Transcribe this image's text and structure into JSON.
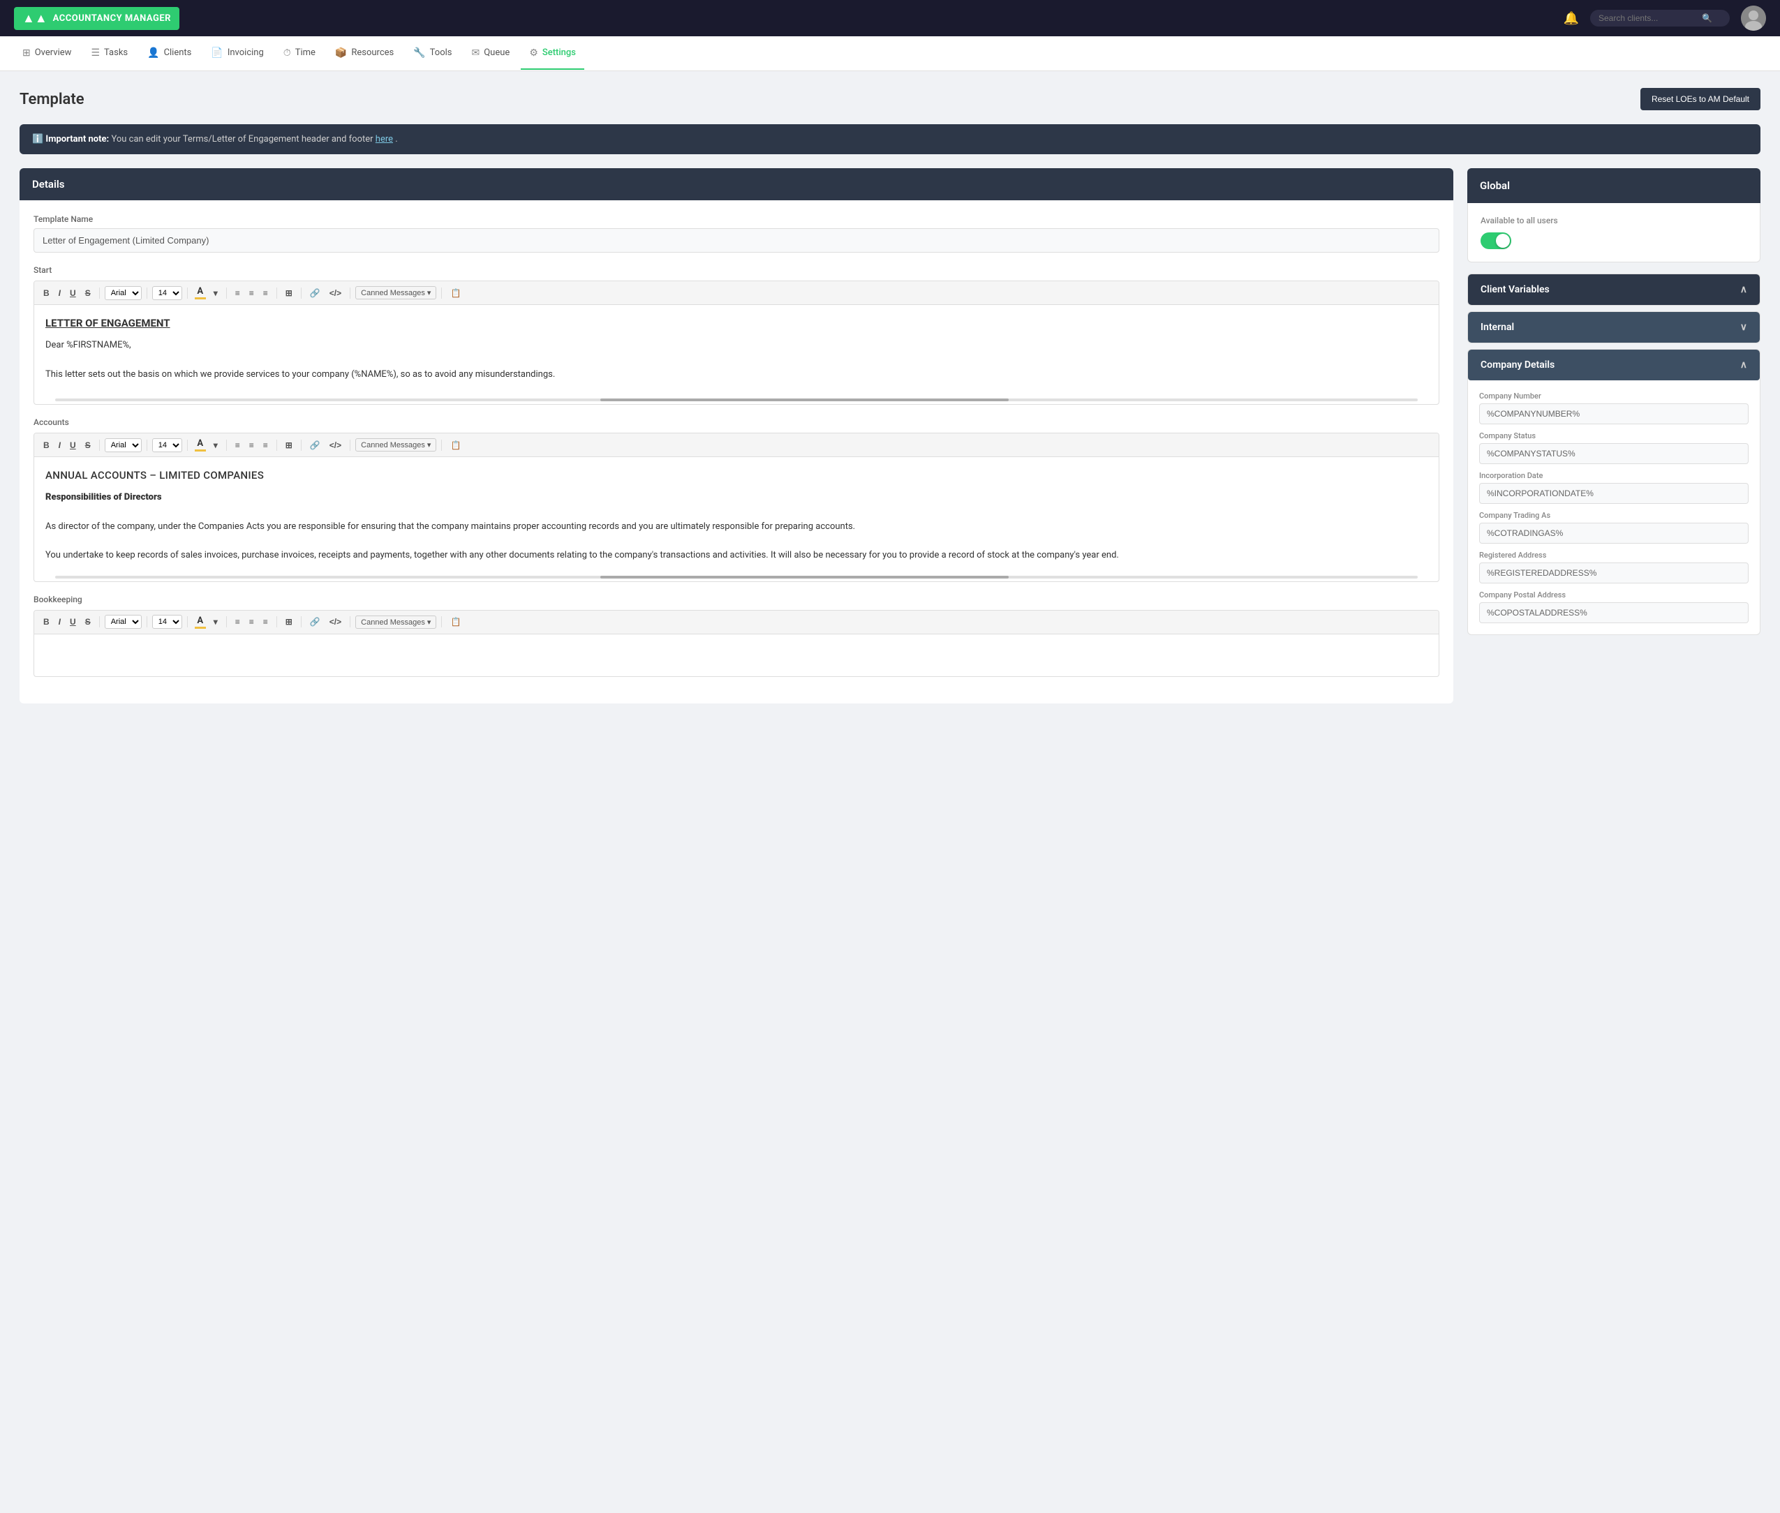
{
  "topNav": {
    "logoText": "ACCOUNTANCY MANAGER",
    "searchPlaceholder": "Search clients...",
    "bellIcon": "🔔"
  },
  "mainNav": {
    "items": [
      {
        "id": "overview",
        "label": "Overview",
        "icon": "⊞"
      },
      {
        "id": "tasks",
        "label": "Tasks",
        "icon": "☰"
      },
      {
        "id": "clients",
        "label": "Clients",
        "icon": "👤"
      },
      {
        "id": "invoicing",
        "label": "Invoicing",
        "icon": "📄"
      },
      {
        "id": "time",
        "label": "Time",
        "icon": "⏱"
      },
      {
        "id": "resources",
        "label": "Resources",
        "icon": "📦"
      },
      {
        "id": "tools",
        "label": "Tools",
        "icon": "🔧"
      },
      {
        "id": "queue",
        "label": "Queue",
        "icon": "✉"
      },
      {
        "id": "settings",
        "label": "Settings",
        "icon": "⚙"
      }
    ]
  },
  "page": {
    "title": "Template",
    "resetButton": "Reset LOEs to AM Default"
  },
  "notice": {
    "prefix": "Important note:",
    "text": " You can edit your Terms/Letter of Engagement header and footer ",
    "linkText": "here",
    "suffix": "."
  },
  "details": {
    "panelTitle": "Details",
    "templateNameLabel": "Template Name",
    "templateNameValue": "Letter of Engagement (Limited Company)"
  },
  "startEditor": {
    "label": "Start",
    "toolbar": {
      "bold": "B",
      "italic": "I",
      "underline": "U",
      "strike": "S",
      "fontFamily": "Arial",
      "fontSize": "14",
      "bullet": "≡",
      "ordered": "≡",
      "align": "≡",
      "table": "⊞",
      "link": "🔗",
      "code": "</>",
      "canned": "Canned Messages",
      "file": "📋"
    },
    "content": {
      "title": "LETTER OF ENGAGEMENT",
      "line1": "Dear %FIRSTNAME%,",
      "line2": "This letter sets out the basis on which we provide services to your company (%NAME%), so as to avoid any misunderstandings."
    }
  },
  "accountsEditor": {
    "label": "Accounts",
    "toolbar": {
      "bold": "B",
      "italic": "I",
      "underline": "U",
      "strike": "S",
      "fontFamily": "Arial",
      "fontSize": "14",
      "canned": "Canned Messages"
    },
    "content": {
      "heading": "ANNUAL ACCOUNTS – LIMITED COMPANIES",
      "subheading": "Responsibilities of Directors",
      "para1": "As director of the company, under the Companies Acts you are responsible for ensuring that the company maintains proper accounting records and you are ultimately responsible for preparing accounts.",
      "para2": "You undertake to keep records of sales invoices, purchase invoices, receipts and payments, together with any other documents relating to the company's transactions and activities. It will also be necessary for you to provide a record of stock at the company's year end."
    }
  },
  "bookkeepingEditor": {
    "label": "Bookkeeping",
    "toolbar": {
      "bold": "B",
      "italic": "I",
      "underline": "U",
      "strike": "S",
      "fontFamily": "Arial",
      "fontSize": "14",
      "canned": "Canned Messages"
    }
  },
  "global": {
    "title": "Global",
    "availableLabel": "Available to all users",
    "toggleOn": true
  },
  "clientVariables": {
    "title": "Client Variables",
    "chevron": "∧"
  },
  "internal": {
    "title": "Internal",
    "chevron": "∨"
  },
  "companyDetails": {
    "title": "Company Details",
    "chevron": "∧",
    "fields": [
      {
        "label": "Company Number",
        "value": "%COMPANYNUMBER%"
      },
      {
        "label": "Company Status",
        "value": "%COMPANYSTATUS%"
      },
      {
        "label": "Incorporation Date",
        "value": "%INCORPORATIONDATE%"
      },
      {
        "label": "Company Trading As",
        "value": "%COTRADINGAS%"
      },
      {
        "label": "Registered Address",
        "value": "%REGISTEREDADDRESS%"
      },
      {
        "label": "Company Postal Address",
        "value": "%COPOSTALADDRESS%"
      }
    ]
  }
}
